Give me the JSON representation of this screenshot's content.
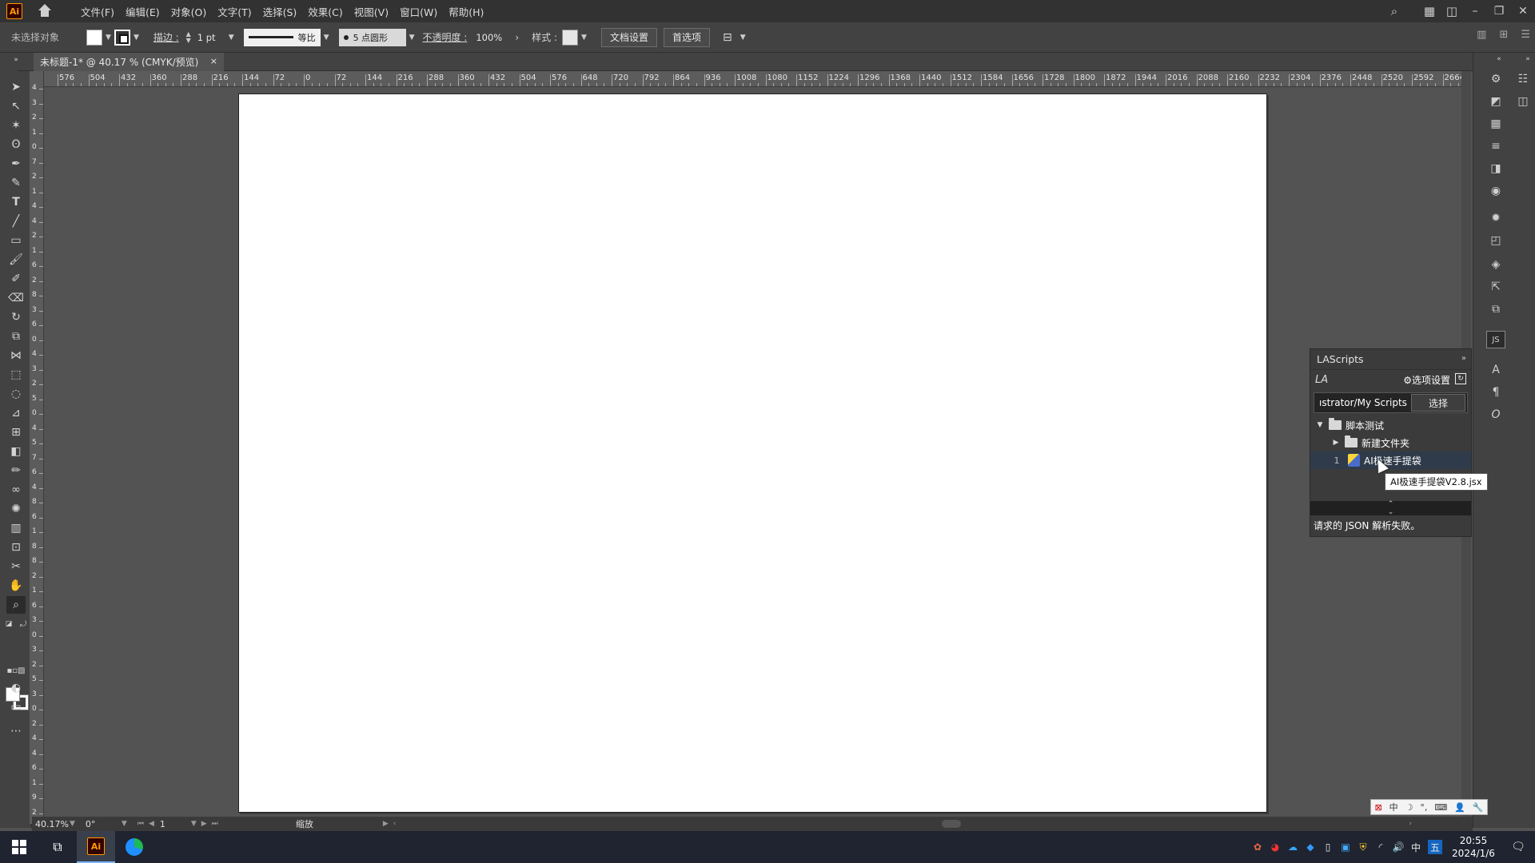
{
  "app": {
    "logo": "Ai",
    "menu": [
      "文件(F)",
      "编辑(E)",
      "对象(O)",
      "文字(T)",
      "选择(S)",
      "效果(C)",
      "视图(V)",
      "窗口(W)",
      "帮助(H)"
    ]
  },
  "controlbar": {
    "selection_status": "未选择对象",
    "stroke_label": "描边 :",
    "stroke_weight": "1 pt",
    "stroke_profile": "等比",
    "brush": "5 点圆形",
    "opacity_label": "不透明度 :",
    "opacity_value": "100%",
    "style_label": "样式 :",
    "doc_setup_button": "文档设置",
    "preferences_button": "首选项"
  },
  "document": {
    "tab_title": "未标题-1* @ 40.17 % (CMYK/预览)",
    "close": "×"
  },
  "ruler": {
    "h_labels": [
      "576",
      "504",
      "432",
      "360",
      "288",
      "216",
      "144",
      "72",
      "0",
      "72",
      "144",
      "216",
      "288",
      "360",
      "432",
      "504",
      "576",
      "648",
      "720",
      "792",
      "864",
      "936",
      "1008",
      "1080",
      "1152",
      "1224",
      "1296",
      "1368",
      "1440",
      "1512",
      "1584",
      "1656",
      "1728",
      "1800",
      "1872",
      "1944",
      "2016",
      "2088",
      "2160",
      "2232",
      "2304",
      "2376",
      "2448",
      "2520",
      "2592",
      "2664"
    ],
    "v_labels": [
      "4",
      "3",
      "2",
      "1",
      "0",
      "7",
      "2",
      "1",
      "4",
      "4",
      "2",
      "1",
      "6",
      "2",
      "8",
      "3",
      "6",
      "0",
      "4",
      "3",
      "2",
      "5",
      "0",
      "4",
      "5",
      "7",
      "6",
      "4",
      "8",
      "6",
      "1",
      "8",
      "8",
      "2",
      "1",
      "6",
      "3",
      "0",
      "3",
      "2",
      "5",
      "3",
      "0",
      "2",
      "4",
      "4",
      "6",
      "1",
      "9",
      "2"
    ]
  },
  "lascripts": {
    "title": "LAScripts",
    "logo": "LA",
    "settings_label": "⚙选项设置",
    "path_text": "ıstrator/My Scripts",
    "choose_button": "选择",
    "tree": {
      "root": "脚本测试",
      "subfolder": "新建文件夹",
      "script_num": "1",
      "script_name": "AI极速手提袋"
    },
    "tooltip": "AI极速手提袋V2.8.jsx",
    "status": "请求的 JSON 解析失败。"
  },
  "statusbar": {
    "zoom": "40.17%",
    "rotation": "0°",
    "artboard": "1",
    "mode": "缩放"
  },
  "ime": [
    "中",
    "☽",
    "°,",
    "⌨",
    "👤",
    "🔧"
  ],
  "taskbar": {
    "time": "20:55",
    "date": "2024/1/6",
    "ime_lang": "中",
    "ime_mode": "五"
  }
}
